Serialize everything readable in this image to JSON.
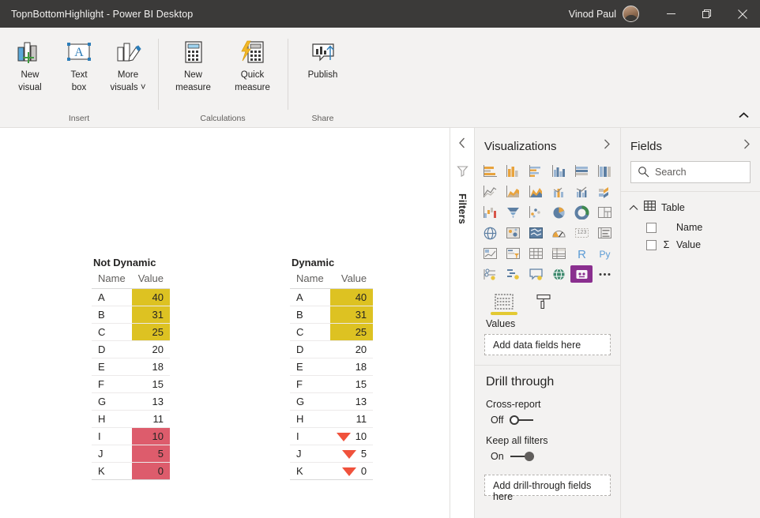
{
  "titlebar": {
    "title": "TopnBottomHighlight - Power BI Desktop",
    "user": "Vinod Paul",
    "minimize_label": "Minimize",
    "restore_label": "Restore",
    "close_label": "Close"
  },
  "ribbon": {
    "groups": [
      {
        "label": "Insert",
        "buttons": [
          {
            "line1": "New",
            "line2": "visual",
            "icon": "new-visual-icon"
          },
          {
            "line1": "Text",
            "line2": "box",
            "icon": "text-box-icon"
          },
          {
            "line1": "More",
            "line2": "visuals ˅",
            "icon": "more-visuals-icon"
          }
        ]
      },
      {
        "label": "Calculations",
        "buttons": [
          {
            "line1": "New",
            "line2": "measure",
            "icon": "new-measure-icon"
          },
          {
            "line1": "Quick",
            "line2": "measure",
            "icon": "quick-measure-icon"
          }
        ]
      },
      {
        "label": "Share",
        "buttons": [
          {
            "line1": "Publish",
            "line2": "",
            "icon": "publish-icon"
          }
        ]
      }
    ],
    "collapse_label": "Collapse the Ribbon"
  },
  "canvas": {
    "visuals": [
      {
        "title": "Not Dynamic",
        "columns": [
          "Name",
          "Value"
        ],
        "rows": [
          {
            "name": "A",
            "value": "40",
            "bg": "#ddc222",
            "icon": ""
          },
          {
            "name": "B",
            "value": "31",
            "bg": "#ddc222",
            "icon": ""
          },
          {
            "name": "C",
            "value": "25",
            "bg": "#ddc222",
            "icon": ""
          },
          {
            "name": "D",
            "value": "20",
            "bg": "",
            "icon": ""
          },
          {
            "name": "E",
            "value": "18",
            "bg": "",
            "icon": ""
          },
          {
            "name": "F",
            "value": "15",
            "bg": "",
            "icon": ""
          },
          {
            "name": "G",
            "value": "13",
            "bg": "",
            "icon": ""
          },
          {
            "name": "H",
            "value": "11",
            "bg": "",
            "icon": ""
          },
          {
            "name": "I",
            "value": "10",
            "bg": "#dd5c6c",
            "icon": ""
          },
          {
            "name": "J",
            "value": "5",
            "bg": "#dd5c6c",
            "icon": ""
          },
          {
            "name": "K",
            "value": "0",
            "bg": "#dd5c6c",
            "icon": ""
          }
        ]
      },
      {
        "title": "Dynamic",
        "columns": [
          "Name",
          "Value"
        ],
        "rows": [
          {
            "name": "A",
            "value": "40",
            "bg": "#ddc222",
            "icon": ""
          },
          {
            "name": "B",
            "value": "31",
            "bg": "#ddc222",
            "icon": ""
          },
          {
            "name": "C",
            "value": "25",
            "bg": "#ddc222",
            "icon": ""
          },
          {
            "name": "D",
            "value": "20",
            "bg": "",
            "icon": ""
          },
          {
            "name": "E",
            "value": "18",
            "bg": "",
            "icon": ""
          },
          {
            "name": "F",
            "value": "15",
            "bg": "",
            "icon": ""
          },
          {
            "name": "G",
            "value": "13",
            "bg": "",
            "icon": ""
          },
          {
            "name": "H",
            "value": "11",
            "bg": "",
            "icon": ""
          },
          {
            "name": "I",
            "value": "10",
            "bg": "",
            "icon": "down-triangle-icon"
          },
          {
            "name": "J",
            "value": "5",
            "bg": "",
            "icon": "down-triangle-icon"
          },
          {
            "name": "K",
            "value": "0",
            "bg": "",
            "icon": "down-triangle-icon"
          }
        ]
      }
    ]
  },
  "filters_pane": {
    "label": "Filters",
    "expand_label": "Expand filters pane"
  },
  "visualizations": {
    "title": "Visualizations",
    "icons": [
      "stacked-bar-chart-icon",
      "stacked-column-chart-icon",
      "clustered-bar-chart-icon",
      "clustered-column-chart-icon",
      "100-percent-stacked-bar-chart-icon",
      "100-percent-stacked-column-chart-icon",
      "line-chart-icon",
      "area-chart-icon",
      "stacked-area-chart-icon",
      "line-stacked-column-chart-icon",
      "line-clustered-column-chart-icon",
      "ribbon-chart-icon",
      "waterfall-chart-icon",
      "funnel-chart-icon",
      "scatter-chart-icon",
      "pie-chart-icon",
      "donut-chart-icon",
      "treemap-icon",
      "map-icon",
      "filled-map-icon",
      "shape-map-icon",
      "gauge-icon",
      "card-icon",
      "multi-row-card-icon",
      "kpi-icon",
      "slicer-icon",
      "table-icon",
      "matrix-icon",
      "r-script-visual-icon",
      "python-visual-icon",
      "key-influencers-icon",
      "decomposition-tree-icon",
      "qna-icon",
      "smart-narrative-icon",
      "paginated-report-icon",
      "more-options-icon"
    ],
    "selected_index": 34,
    "tabs": [
      {
        "name": "fields-tab",
        "icon": "fields-tab-icon",
        "active": true
      },
      {
        "name": "format-tab",
        "icon": "paint-roller-icon",
        "active": false
      }
    ],
    "values_label": "Values",
    "values_placeholder": "Add data fields here",
    "drillthrough": {
      "title": "Drill through",
      "cross_report_label": "Cross-report",
      "cross_report_state": "Off",
      "keep_all_filters_label": "Keep all filters",
      "keep_all_filters_state": "On",
      "placeholder": "Add drill-through fields here"
    }
  },
  "fields": {
    "title": "Fields",
    "search_placeholder": "Search",
    "search_value": "",
    "table_name": "Table",
    "items": [
      {
        "label": "Name",
        "measure": false
      },
      {
        "label": "Value",
        "measure": true,
        "sigma": "Σ"
      }
    ]
  },
  "colors": {
    "titlebar_bg": "#3b3a39",
    "ribbon_bg": "#f3f2f1",
    "highlight_top": "#ddc222",
    "highlight_bottom": "#dd5c6c",
    "triangle": "#f0523c",
    "accent_tab": "#e3c932"
  }
}
